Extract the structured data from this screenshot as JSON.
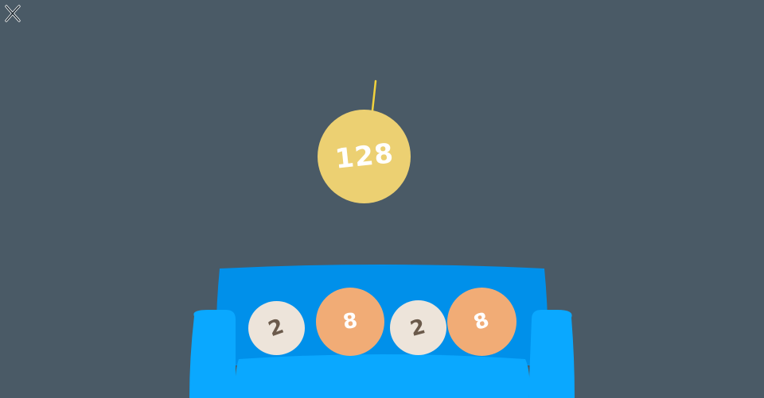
{
  "game": {
    "close_icon": "close-x-icon",
    "hanging_ball": {
      "value": "128",
      "color": "#ecd072",
      "string_color": "#f2d23d"
    },
    "couch_color": "#0aa8ff",
    "couch_back_color": "#0090ea",
    "couch_balls": [
      {
        "value": "2",
        "color": "#ede4da",
        "text_color": "#6b5a4b"
      },
      {
        "value": "8",
        "color": "#f1ac76",
        "text_color": "#ffffff"
      },
      {
        "value": "2",
        "color": "#ede4da",
        "text_color": "#6b5a4b"
      },
      {
        "value": "8",
        "color": "#f1ac76",
        "text_color": "#ffffff"
      }
    ]
  }
}
